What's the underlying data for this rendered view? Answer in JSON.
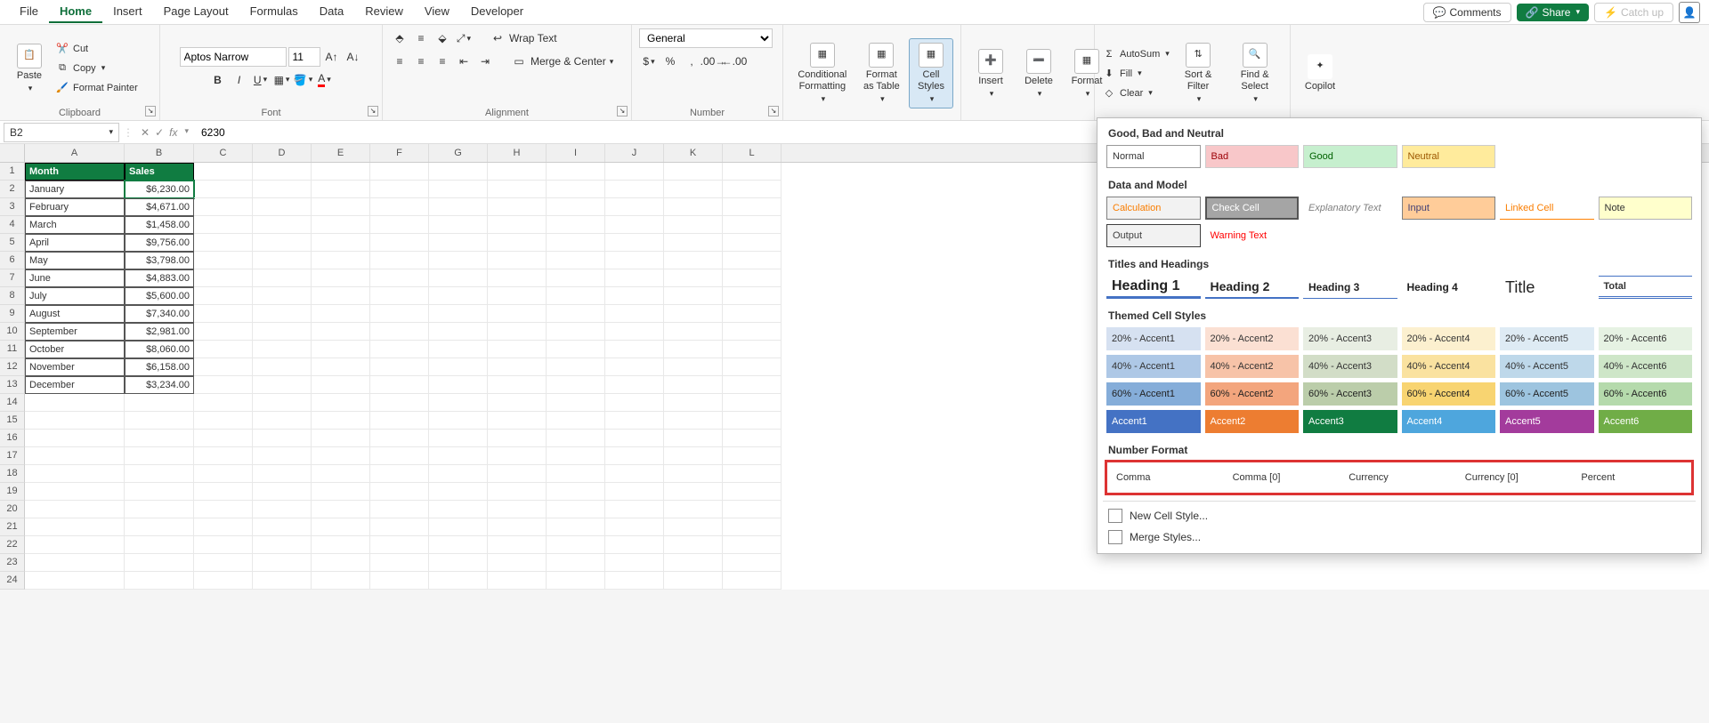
{
  "menu": {
    "items": [
      "File",
      "Home",
      "Insert",
      "Page Layout",
      "Formulas",
      "Data",
      "Review",
      "View",
      "Developer"
    ],
    "active": "Home",
    "comments": "Comments",
    "share": "Share",
    "catchup": "Catch up"
  },
  "ribbon": {
    "clipboard": {
      "label": "Clipboard",
      "paste": "Paste",
      "cut": "Cut",
      "copy": "Copy",
      "painter": "Format Painter"
    },
    "font": {
      "label": "Font",
      "name": "Aptos Narrow",
      "size": "11"
    },
    "alignment": {
      "label": "Alignment",
      "wrap": "Wrap Text",
      "merge": "Merge & Center"
    },
    "number": {
      "label": "Number",
      "format": "General"
    },
    "styles": {
      "cond": "Conditional Formatting",
      "table": "Format as Table",
      "cell": "Cell Styles"
    },
    "cells": {
      "insert": "Insert",
      "delete": "Delete",
      "format": "Format"
    },
    "editing": {
      "autosum": "AutoSum",
      "fill": "Fill",
      "clear": "Clear",
      "sort": "Sort & Filter",
      "find": "Find & Select"
    },
    "copilot": "Copilot"
  },
  "formula": {
    "name": "B2",
    "value": "6230"
  },
  "columns": [
    "A",
    "B",
    "C",
    "D",
    "E",
    "F",
    "G",
    "H",
    "I",
    "J",
    "K",
    "L"
  ],
  "headers": {
    "a": "Month",
    "b": "Sales"
  },
  "rows": [
    {
      "month": "January",
      "sales": "$6,230.00"
    },
    {
      "month": "February",
      "sales": "$4,671.00"
    },
    {
      "month": "March",
      "sales": "$1,458.00"
    },
    {
      "month": "April",
      "sales": "$9,756.00"
    },
    {
      "month": "May",
      "sales": "$3,798.00"
    },
    {
      "month": "June",
      "sales": "$4,883.00"
    },
    {
      "month": "July",
      "sales": "$5,600.00"
    },
    {
      "month": "August",
      "sales": "$7,340.00"
    },
    {
      "month": "September",
      "sales": "$2,981.00"
    },
    {
      "month": "October",
      "sales": "$8,060.00"
    },
    {
      "month": "November",
      "sales": "$6,158.00"
    },
    {
      "month": "December",
      "sales": "$3,234.00"
    }
  ],
  "styles_panel": {
    "s1": "Good, Bad and Neutral",
    "normal": "Normal",
    "bad": "Bad",
    "good": "Good",
    "neutral": "Neutral",
    "s2": "Data and Model",
    "calc": "Calculation",
    "check": "Check Cell",
    "expl": "Explanatory Text",
    "input": "Input",
    "linked": "Linked Cell",
    "note": "Note",
    "output": "Output",
    "warn": "Warning Text",
    "s3": "Titles and Headings",
    "h1": "Heading 1",
    "h2": "Heading 2",
    "h3": "Heading 3",
    "h4": "Heading 4",
    "title": "Title",
    "total": "Total",
    "s4": "Themed Cell Styles",
    "accents20": [
      "20% - Accent1",
      "20% - Accent2",
      "20% - Accent3",
      "20% - Accent4",
      "20% - Accent5",
      "20% - Accent6"
    ],
    "accents40": [
      "40% - Accent1",
      "40% - Accent2",
      "40% - Accent3",
      "40% - Accent4",
      "40% - Accent5",
      "40% - Accent6"
    ],
    "accents60": [
      "60% - Accent1",
      "60% - Accent2",
      "60% - Accent3",
      "60% - Accent4",
      "60% - Accent5",
      "60% - Accent6"
    ],
    "accents": [
      "Accent1",
      "Accent2",
      "Accent3",
      "Accent4",
      "Accent5",
      "Accent6"
    ],
    "accentColors20": [
      "#d6e1f1",
      "#fbe0d3",
      "#e8eee3",
      "#fcf0cf",
      "#deebf4",
      "#e6f2e3"
    ],
    "accentColors40": [
      "#aec8e6",
      "#f7c3a8",
      "#d2ddc7",
      "#fae2a0",
      "#bed8ea",
      "#cee6c8"
    ],
    "accentColors60": [
      "#85add9",
      "#f3a57d",
      "#bbcdaa",
      "#f8d471",
      "#9dc4df",
      "#b5daac"
    ],
    "accentColors": [
      "#4472c4",
      "#ed7d31",
      "#70ad47",
      "#ffc000",
      "#5b9bd5",
      "#70ad47"
    ],
    "accentColorsReal": [
      "#4472c4",
      "#ed7d31",
      "#107c41",
      "#ffc000",
      "#5b9bd5",
      "#70ad47"
    ],
    "s5": "Number Format",
    "numfmt": [
      "Comma",
      "Comma [0]",
      "Currency",
      "Currency [0]",
      "Percent"
    ],
    "newstyle": "New Cell Style...",
    "mergestyle": "Merge Styles..."
  }
}
